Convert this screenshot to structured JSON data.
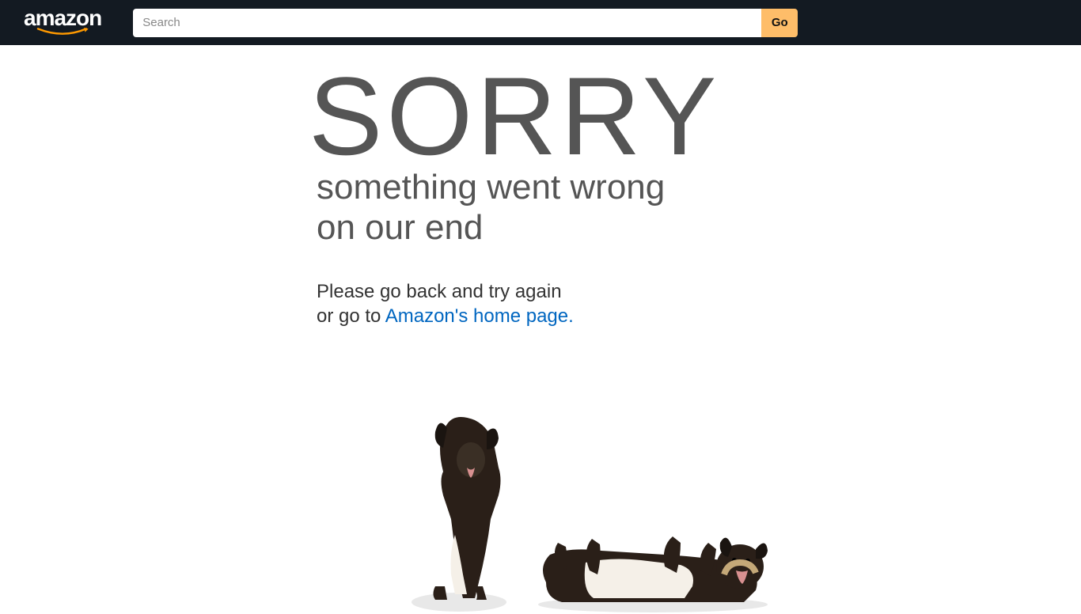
{
  "header": {
    "logo_text": "amazon",
    "search_placeholder": "Search",
    "search_button_label": "Go"
  },
  "error": {
    "heading": "SORRY",
    "subheading_line1": "something went wrong",
    "subheading_line2": "on our end",
    "instruction_line1": "Please go back and try again",
    "instruction_line2_prefix": "or go to ",
    "home_link_text": "Amazon's home page."
  }
}
